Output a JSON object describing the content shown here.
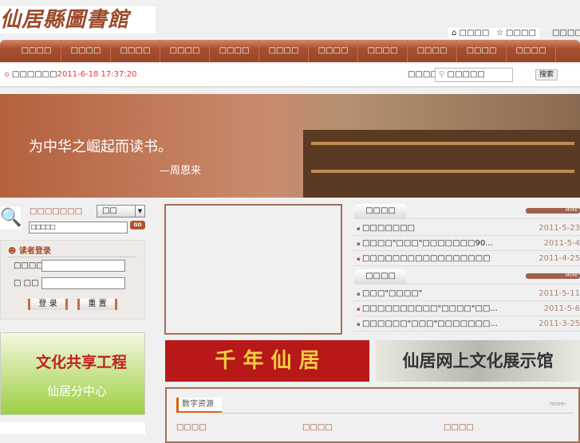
{
  "logo": "仙居縣圖書館",
  "top_links": [
    "□□□□",
    "□□□□",
    "□□□□"
  ],
  "nav": [
    "□□□□",
    "□□□□",
    "□□□□",
    "□□□□",
    "□□□□",
    "□□□□",
    "□□□□",
    "□□□□",
    "□□□□",
    "□□□□",
    "□□□□"
  ],
  "info": {
    "label": "□□□□□□",
    "datetime": "2011-6-18 17:37:20",
    "search_label": "□□□□□",
    "search_value": "□□□□□",
    "search_button": "搜索"
  },
  "banner": {
    "quote": "为中华之崛起而读书。",
    "author": "—周恩来"
  },
  "search_box": {
    "title": "□□□□□□□",
    "select": "□□",
    "input": "□□□□□",
    "go": "GO"
  },
  "login": {
    "title": "读者登录",
    "user_label": "□□□□",
    "pass_label": "□ □□",
    "login": "登 录",
    "reset": "重 置"
  },
  "promo": {
    "title": "文化共享工程",
    "subtitle": "仙居分中心"
  },
  "news1": {
    "tab": "□□□□",
    "more": "MORE",
    "items": [
      {
        "t": "□□□□□□□",
        "d": "2011-5-23"
      },
      {
        "t": "□□□□\"□□□\"□□□□□□□90...",
        "d": "2011-5-4"
      },
      {
        "t": "□□□□□□□□□□□□□□□□□",
        "d": "2011-4-25"
      }
    ]
  },
  "news2": {
    "tab": "□□□□",
    "more": "MORE",
    "items": [
      {
        "t": "□□□\"□□□□\"",
        "d": "2011-5-11"
      },
      {
        "t": "□□□□□□□□□□\"□□□□\"□□...",
        "d": "2011-5-6"
      },
      {
        "t": "□□□□□□\"□□□\"□□□□□□□...",
        "d": "2011-3-25"
      }
    ]
  },
  "ads": [
    "千 年 仙 居",
    "仙居网上文化展示馆"
  ],
  "digital": {
    "title": "数字资源",
    "more": "more›",
    "cols": [
      "□□□□",
      "□□□□",
      "□□□□"
    ]
  }
}
